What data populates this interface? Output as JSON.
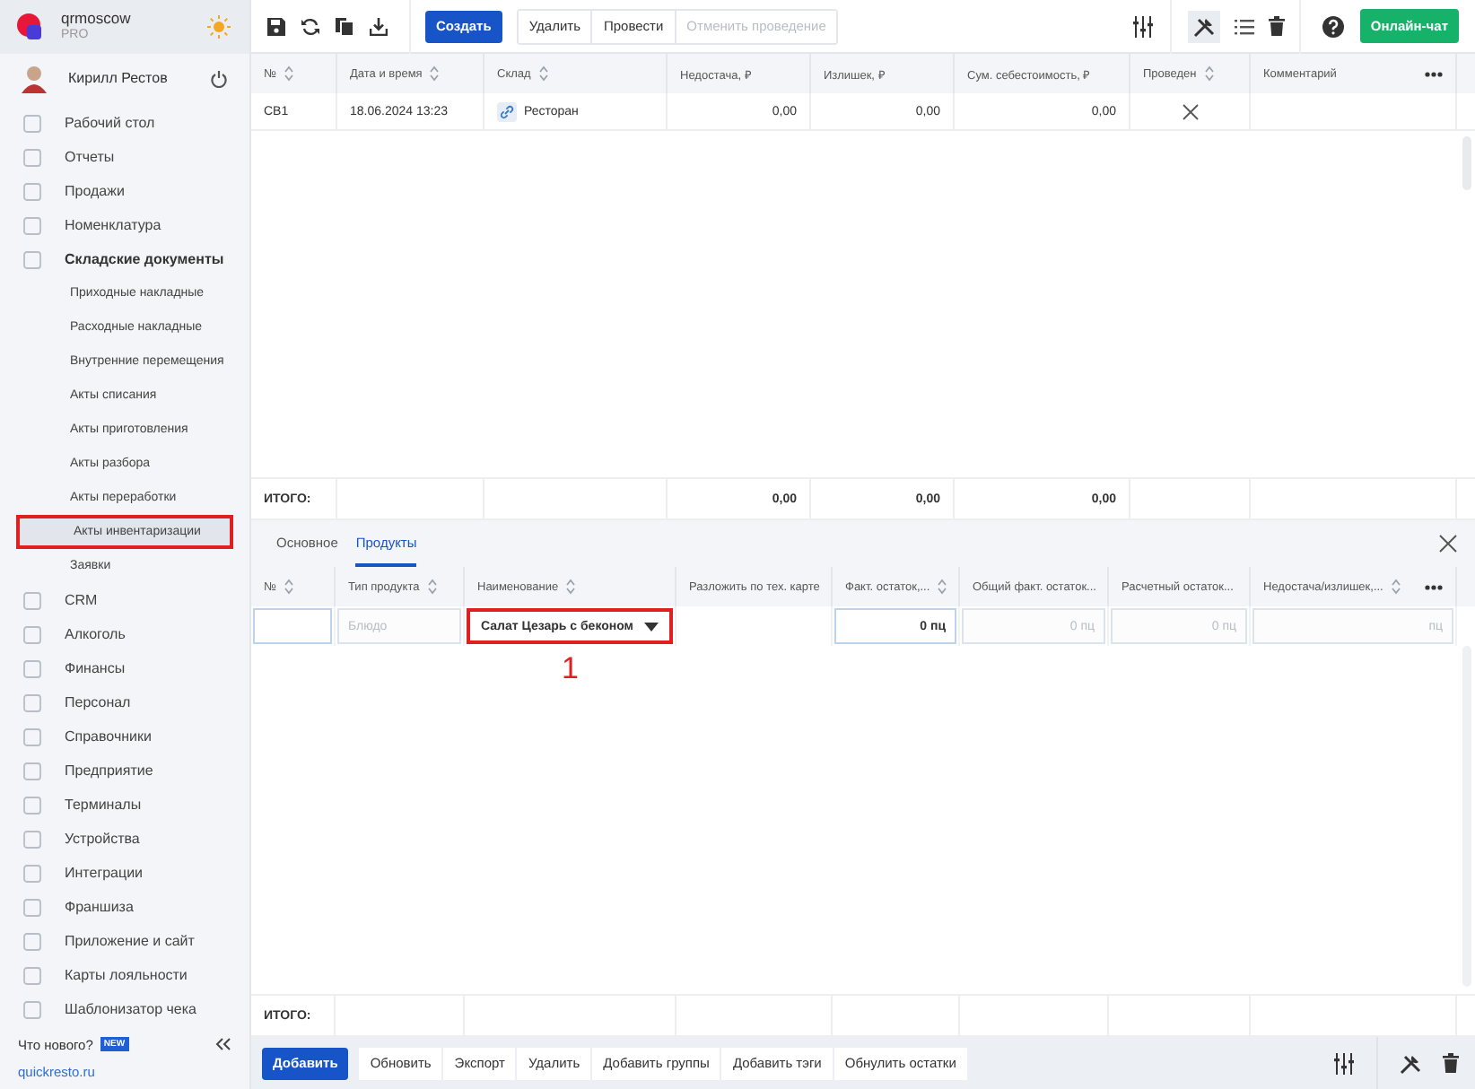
{
  "sidebar": {
    "brand": "qrmoscow",
    "plan": "PRO",
    "user": "Кирилл Рестов",
    "items": [
      {
        "label": "Рабочий стол",
        "expanded": false
      },
      {
        "label": "Отчеты",
        "expanded": false
      },
      {
        "label": "Продажи",
        "expanded": false
      },
      {
        "label": "Номенклатура",
        "expanded": false
      },
      {
        "label": "Складские документы",
        "expanded": true,
        "children": [
          {
            "label": "Приходные накладные",
            "selected": false,
            "highlighted": false
          },
          {
            "label": "Расходные накладные",
            "selected": false,
            "highlighted": false
          },
          {
            "label": "Внутренние перемещения",
            "selected": false,
            "highlighted": false
          },
          {
            "label": "Акты списания",
            "selected": false,
            "highlighted": false
          },
          {
            "label": "Акты приготовления",
            "selected": false,
            "highlighted": false
          },
          {
            "label": "Акты разбора",
            "selected": false,
            "highlighted": false
          },
          {
            "label": "Акты переработки",
            "selected": false,
            "highlighted": false
          },
          {
            "label": "Акты инвентаризации",
            "selected": true,
            "highlighted": true
          },
          {
            "label": "Заявки",
            "selected": false,
            "highlighted": false
          }
        ]
      },
      {
        "label": "CRM",
        "expanded": false
      },
      {
        "label": "Алкоголь",
        "expanded": false
      },
      {
        "label": "Финансы",
        "expanded": false
      },
      {
        "label": "Персонал",
        "expanded": false
      },
      {
        "label": "Справочники",
        "expanded": false
      },
      {
        "label": "Предприятие",
        "expanded": false
      },
      {
        "label": "Терминалы",
        "expanded": false
      },
      {
        "label": "Устройства",
        "expanded": false
      },
      {
        "label": "Интеграции",
        "expanded": false
      },
      {
        "label": "Франшиза",
        "expanded": false
      },
      {
        "label": "Приложение и сайт",
        "expanded": false
      },
      {
        "label": "Карты лояльности",
        "expanded": false
      },
      {
        "label": "Шаблонизатор чека",
        "expanded": false
      }
    ],
    "whats_new": "Что нового?",
    "new_badge": "NEW",
    "site_link": "quickresto.ru"
  },
  "toolbar": {
    "buttons": [
      {
        "label": "Создать",
        "kind": "primary",
        "disabled": false
      },
      {
        "label": "Удалить",
        "kind": "plain",
        "disabled": false
      },
      {
        "label": "Провести",
        "kind": "plain",
        "disabled": false
      },
      {
        "label": "Отменить проведение",
        "kind": "plain",
        "disabled": true
      }
    ],
    "chat_button": "Онлайн-чат"
  },
  "documents_table": {
    "columns": [
      {
        "label": "№",
        "sortable": true
      },
      {
        "label": "Дата и время",
        "sortable": true
      },
      {
        "label": "Склад",
        "sortable": true
      },
      {
        "label": "Недостача, ₽",
        "sortable": false,
        "total": "0,00"
      },
      {
        "label": "Излишек, ₽",
        "sortable": false,
        "total": "0,00"
      },
      {
        "label": "Сум. себестоимость, ₽",
        "sortable": false,
        "total": "0,00"
      },
      {
        "label": "Проведен",
        "sortable": true
      },
      {
        "label": "Комментарий",
        "sortable": false
      }
    ],
    "rows": [
      {
        "selected": false,
        "number": "СВ1",
        "datetime": "18.06.2024 13:23",
        "warehouse": "Ресторан",
        "shortage": "0,00",
        "surplus": "0,00",
        "cost": "0,00",
        "posted": false
      }
    ],
    "total_label": "ИТОГО:"
  },
  "detail": {
    "tabs": [
      {
        "label": "Основное",
        "selected": false
      },
      {
        "label": "Продукты",
        "selected": true
      }
    ],
    "columns": [
      {
        "label": "№",
        "sortable": true
      },
      {
        "label": "Тип продукта",
        "sortable": true
      },
      {
        "label": "Наименование",
        "sortable": true
      },
      {
        "label": "Разложить по тех. карте",
        "sortable": false
      },
      {
        "label": "Факт. остаток,...",
        "sortable": true
      },
      {
        "label": "Общий факт. остаток...",
        "sortable": false
      },
      {
        "label": "Расчетный остаток...",
        "sortable": false
      },
      {
        "label": "Недостача/излишек,...",
        "sortable": true
      }
    ],
    "rows": [
      {
        "cells": [
          {
            "kind": "input"
          },
          {
            "kind": "input",
            "text": "Блюдо",
            "disabled": true
          },
          {
            "kind": "select",
            "text": "Салат Цезарь с беконом",
            "highlighted": true
          },
          {
            "kind": "blank"
          },
          {
            "kind": "input",
            "text": "0 пц",
            "disabled": false
          },
          {
            "kind": "input",
            "text": "0 пц",
            "disabled": true
          },
          {
            "kind": "input",
            "text": "0 пц",
            "disabled": true
          },
          {
            "kind": "input",
            "text": "пц",
            "disabled": true
          }
        ]
      }
    ],
    "annotation": "1",
    "total_label": "ИТОГО:",
    "buttons": [
      {
        "label": "Добавить",
        "kind": "primary"
      },
      {
        "label": "Обновить",
        "kind": "plain"
      },
      {
        "label": "Экспорт",
        "kind": "plain"
      },
      {
        "label": "Удалить",
        "kind": "plain"
      },
      {
        "label": "Добавить группы",
        "kind": "plain"
      },
      {
        "label": "Добавить тэги",
        "kind": "plain"
      },
      {
        "label": "Обнулить остатки",
        "kind": "plain"
      }
    ]
  }
}
